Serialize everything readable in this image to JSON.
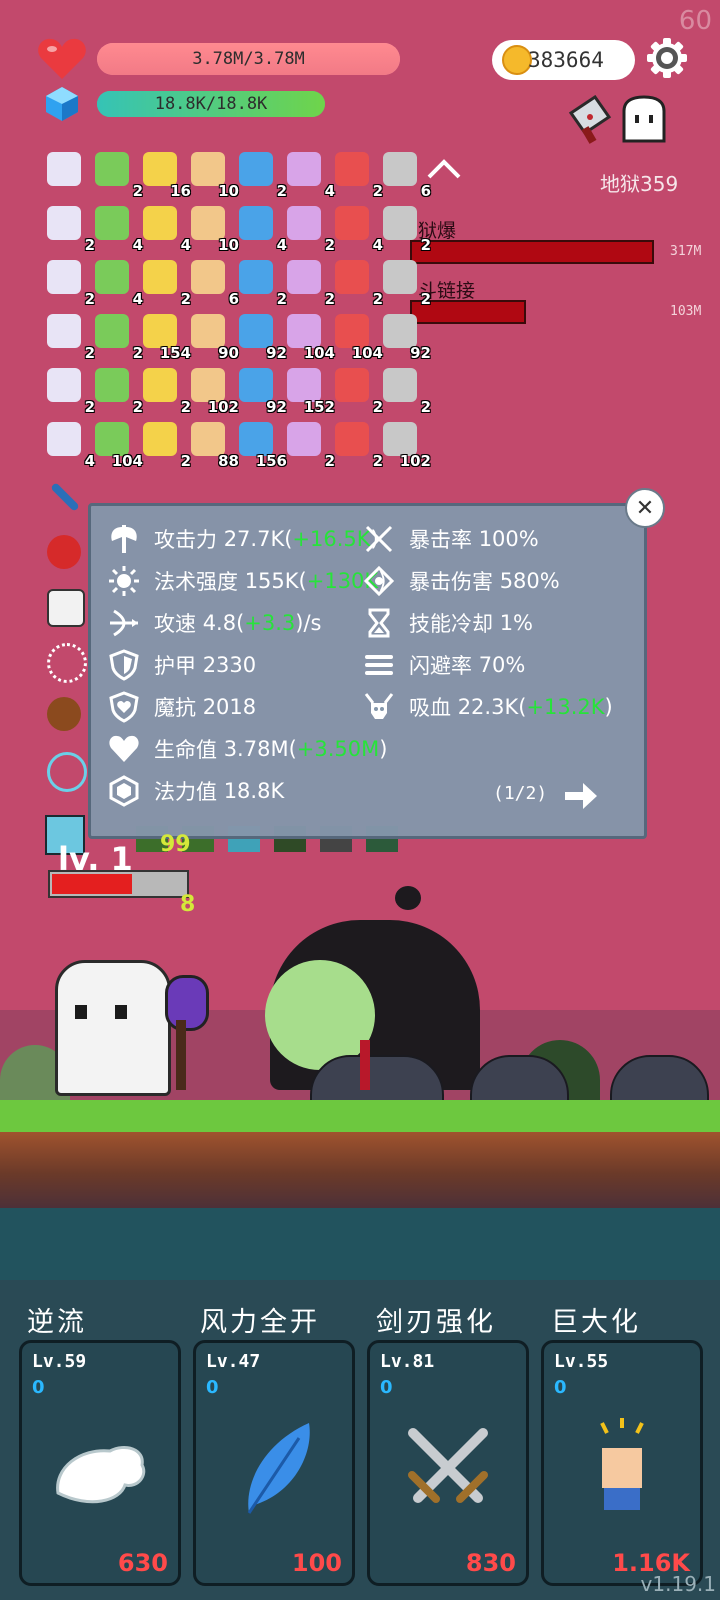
{
  "fps": "60",
  "player": {
    "hp_text": "3.78M/3.78M",
    "mp_text": "18.8K/18.8K",
    "gold": "383664"
  },
  "stage": {
    "label": "地狱359"
  },
  "enemies": [
    {
      "name": "狱爆",
      "hp": "317M"
    },
    {
      "name": "斗链接",
      "hp": "103M"
    }
  ],
  "items": [
    {
      "icon": "scroll-ribbon-icon",
      "count": ""
    },
    {
      "icon": "scroll-ribbon-icon",
      "count": "2"
    },
    {
      "icon": "map-scroll-icon",
      "count": "16"
    },
    {
      "icon": "treasure-map-icon",
      "count": "10"
    },
    {
      "icon": "scroll-ribbon-icon",
      "count": "2"
    },
    {
      "icon": "hook-icon",
      "count": "4"
    },
    {
      "icon": "bomb-icon",
      "count": "2"
    },
    {
      "icon": "target-icon",
      "count": "6"
    },
    {
      "icon": "jade-figure-icon",
      "count": "2"
    },
    {
      "icon": "flame-drop-icon",
      "count": "4"
    },
    {
      "icon": "lime-icon",
      "count": "4"
    },
    {
      "icon": "speech-bubble-icon",
      "count": "10"
    },
    {
      "icon": "green-book-icon",
      "count": "4"
    },
    {
      "icon": "safety-pin-icon",
      "count": "2"
    },
    {
      "icon": "compass-icon",
      "count": "4"
    },
    {
      "icon": "fire-ring-icon",
      "count": "2"
    },
    {
      "icon": "heat-waves-icon",
      "count": "2"
    },
    {
      "icon": "map-pin-icon",
      "count": "4"
    },
    {
      "icon": "sun-icon",
      "count": "2"
    },
    {
      "icon": "tea-cup-icon",
      "count": "6"
    },
    {
      "icon": "snake-icon",
      "count": "2"
    },
    {
      "icon": "fire-icon",
      "count": "2"
    },
    {
      "icon": "question-mark-icon",
      "count": "2"
    },
    {
      "icon": "list-note-icon",
      "count": "2"
    },
    {
      "icon": "ruby-icon",
      "count": "2"
    },
    {
      "icon": "mushroom-icon",
      "count": "2"
    },
    {
      "icon": "pirate-ship-icon",
      "count": "154"
    },
    {
      "icon": "potion-bottle-icon",
      "count": "90"
    },
    {
      "icon": "elephant-icon",
      "count": "92"
    },
    {
      "icon": "sword-slash-icon",
      "count": "104"
    },
    {
      "icon": "spell-book-icon",
      "count": "104"
    },
    {
      "icon": "tombstone-icon",
      "count": "92"
    },
    {
      "icon": "crown-icon",
      "count": "2"
    },
    {
      "icon": "suitcase-icon",
      "count": "2"
    },
    {
      "icon": "shirt-icon",
      "count": "2"
    },
    {
      "icon": "watermelon-icon",
      "count": "102"
    },
    {
      "icon": "envelope-icon",
      "count": "92"
    },
    {
      "icon": "flag-icon",
      "count": "152"
    },
    {
      "icon": "thermometer-icon",
      "count": "2"
    },
    {
      "icon": "star-card-icon",
      "count": "2"
    },
    {
      "icon": "parchment-icon",
      "count": "4"
    },
    {
      "icon": "eraser-icon",
      "count": "104"
    },
    {
      "icon": "pineapple-icon",
      "count": "2"
    },
    {
      "icon": "sunflower-icon",
      "count": "88"
    },
    {
      "icon": "disc-icon",
      "count": "156"
    },
    {
      "icon": "ice-cream-icon",
      "count": "2"
    },
    {
      "icon": "beer-mug-icon",
      "count": "2"
    },
    {
      "icon": "fried-egg-icon",
      "count": "102"
    }
  ],
  "stats_panel": {
    "page": "(1/2)",
    "stats": [
      {
        "icon": "axe-icon",
        "label": "攻击力",
        "value": "27.7K(",
        "bonus": "+16.5K",
        "tail": ")"
      },
      {
        "icon": "crossed-swords-icon",
        "label": "暴击率",
        "value": "100%",
        "bonus": "",
        "tail": ""
      },
      {
        "icon": "sun-burst-icon",
        "label": "法术强度",
        "value": "155K(",
        "bonus": "+130K",
        "tail": ")"
      },
      {
        "icon": "crit-diamond-icon",
        "label": "暴击伤害",
        "value": "580%",
        "bonus": "",
        "tail": ""
      },
      {
        "icon": "bow-icon",
        "label": "攻速",
        "value": "4.8(",
        "bonus": "+3.3",
        "tail": ")/s"
      },
      {
        "icon": "hourglass-icon",
        "label": "技能冷却",
        "value": "1%",
        "bonus": "",
        "tail": ""
      },
      {
        "icon": "shield-icon",
        "label": "护甲",
        "value": "2330",
        "bonus": "",
        "tail": ""
      },
      {
        "icon": "dodge-lines-icon",
        "label": "闪避率",
        "value": "70%",
        "bonus": "",
        "tail": ""
      },
      {
        "icon": "magic-shield-icon",
        "label": "魔抗",
        "value": "2018",
        "bonus": "",
        "tail": ""
      },
      {
        "icon": "horned-skull-icon",
        "label": "吸血",
        "value": "22.3K(",
        "bonus": "+13.2K",
        "tail": ")"
      },
      {
        "icon": "heart-icon",
        "label": "生命值",
        "value": "3.78M(",
        "bonus": "+3.50M",
        "tail": ")"
      },
      {
        "icon": "crystal-icon",
        "label": "法力值",
        "value": "18.8K",
        "bonus": "",
        "tail": ""
      }
    ]
  },
  "hero": {
    "level_text": "lv. 1",
    "floating_numbers": [
      "99",
      "8"
    ]
  },
  "skills": [
    {
      "name": "逆流",
      "level": "Lv.59",
      "points": "0",
      "cost": "630",
      "icon": "angel-wing-icon"
    },
    {
      "name": "风力全开",
      "level": "Lv.47",
      "points": "0",
      "cost": "100",
      "icon": "blue-feather-icon"
    },
    {
      "name": "剑刃强化",
      "level": "Lv.81",
      "points": "0",
      "cost": "830",
      "icon": "crossed-swords-icon"
    },
    {
      "name": "巨大化",
      "level": "Lv.55",
      "points": "0",
      "cost": "1.16K",
      "icon": "raised-fist-icon"
    }
  ],
  "version": "v1.19.1",
  "colors": {
    "background": "#c2496c",
    "bonus_green": "#27e33a",
    "cost_red": "#ff4a4a",
    "points_blue": "#2ab8ff"
  }
}
